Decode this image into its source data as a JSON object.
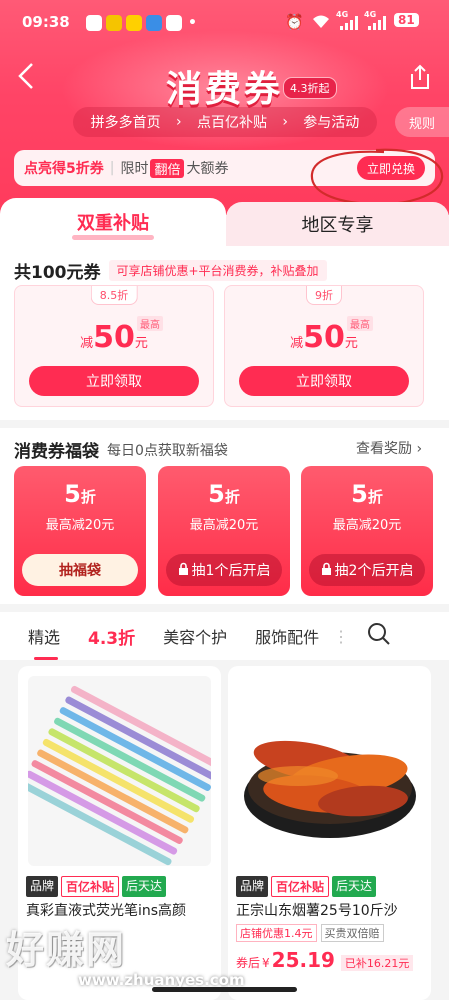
{
  "status_bar": {
    "time": "09:38",
    "battery": "81",
    "network_1": "4G",
    "network_2": "4G"
  },
  "header": {
    "title": "消费券",
    "title_badge": "4.3折起",
    "breadcrumb": [
      "拼多多首页",
      "点百亿补贴",
      "参与活动"
    ],
    "rules_label": "规则",
    "promo_text_1": "点亮得5折券",
    "promo_text_2": "限时",
    "promo_tag": "翻倍",
    "promo_text_3": "大额券",
    "promo_button": "立即兑换",
    "annotation_color": "#d22b2b"
  },
  "tabs": {
    "active": "双重补贴",
    "inactive": "地区专享"
  },
  "coupon_section": {
    "title": "共100元券",
    "pill": "可享店铺优惠+平台消费券，补贴叠加",
    "coupons": [
      {
        "discount": "8.5折",
        "prefix": "减",
        "amount": "50",
        "unit": "元",
        "max_label": "最高",
        "button": "立即领取"
      },
      {
        "discount": "9折",
        "prefix": "减",
        "amount": "50",
        "unit": "元",
        "max_label": "最高",
        "button": "立即领取"
      }
    ]
  },
  "lucky_bag": {
    "title": "消费券福袋",
    "subtitle": "每日0点获取新福袋",
    "view_rewards": "查看奖励",
    "bags": [
      {
        "discount": "5",
        "unit": "折",
        "max": "最高减20元",
        "button": "抽福袋"
      },
      {
        "discount": "5",
        "unit": "折",
        "max": "最高减20元",
        "button": "抽1个后开启"
      },
      {
        "discount": "5",
        "unit": "折",
        "max": "最高减20元",
        "button": "抽2个后开启"
      }
    ]
  },
  "category_nav": {
    "items": [
      "精选",
      "4.3折",
      "美容个护",
      "服饰配件"
    ]
  },
  "products": [
    {
      "badges": [
        "品牌",
        "百亿补贴",
        "后天达"
      ],
      "name": "真彩直液式荧光笔ins高颜",
      "chip_1": "",
      "chip_2": "",
      "price_prefix": "券后",
      "price_symbol": "¥",
      "price": "",
      "subsidy": ""
    },
    {
      "badges": [
        "品牌",
        "百亿补贴",
        "后天达"
      ],
      "name": "正宗山东烟薯25号10斤沙",
      "chip_1": "店铺优惠1.4元",
      "chip_2": "买贵双倍赔",
      "price_prefix": "券后",
      "price_symbol": "¥",
      "price": "25.19",
      "subsidy": "已补16.21元"
    }
  ],
  "watermark": {
    "text": "好赚网",
    "url": "www.zhuanyes.com"
  },
  "colors": {
    "brand_red": "#ff2c52",
    "header_pink": "#ff4466",
    "green": "#22a94f"
  }
}
